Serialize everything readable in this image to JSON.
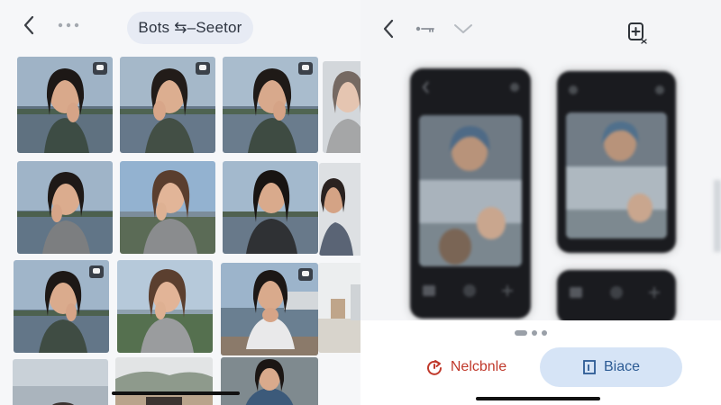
{
  "left": {
    "back_icon": "chevron-left-icon",
    "more_icon": "more-dots-icon",
    "title": "Bots ⇆–Seetor",
    "thumbs": [
      {
        "badge": true
      },
      {
        "badge": true
      },
      {
        "badge": true
      },
      {
        "badge": false
      },
      {
        "badge": false
      },
      {
        "badge": false
      },
      {
        "badge": false
      },
      {
        "badge": false
      },
      {
        "badge": true
      },
      {
        "badge": false
      },
      {
        "badge": true
      },
      {
        "badge": false
      },
      {
        "badge": false
      },
      {
        "badge": false
      },
      {
        "badge": false
      }
    ]
  },
  "right": {
    "back_icon": "chevron-left-icon",
    "key_icon": "key-icon",
    "check_icon": "chevron-down-icon",
    "add_icon": "add-page-icon",
    "neutral_button": {
      "label": "Nelcbnle",
      "icon": "rotate-icon"
    },
    "primary_button": {
      "label": "Biace",
      "icon": "window-icon"
    }
  }
}
